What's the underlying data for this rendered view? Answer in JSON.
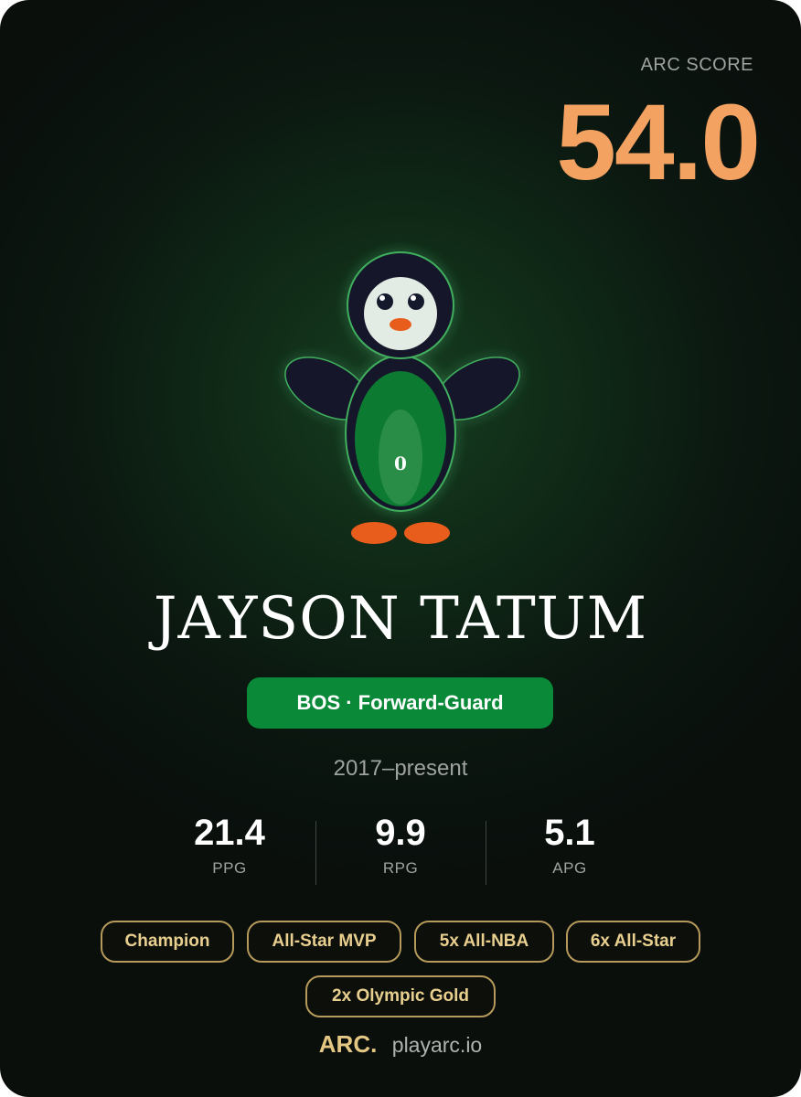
{
  "score": {
    "label": "ARC SCORE",
    "value": "54.0"
  },
  "mascot": {
    "jersey_text": "0"
  },
  "player": {
    "name": "JAYSON TATUM",
    "team_position": "BOS · Forward-Guard",
    "years": "2017–present"
  },
  "stats": [
    {
      "value": "21.4",
      "label": "PPG"
    },
    {
      "value": "9.9",
      "label": "RPG"
    },
    {
      "value": "5.1",
      "label": "APG"
    }
  ],
  "badges": [
    "Champion",
    "All-Star MVP",
    "5x All-NBA",
    "6x All-Star",
    "2x Olympic Gold"
  ],
  "footer": {
    "brand": "ARC.",
    "url": "playarc.io"
  },
  "colors": {
    "score": "#f3a262",
    "team_green": "#0a8a39",
    "badge_gold": "#e8cf8f",
    "mascot_body": "#0f7a33",
    "mascot_feet": "#e85d1c"
  }
}
